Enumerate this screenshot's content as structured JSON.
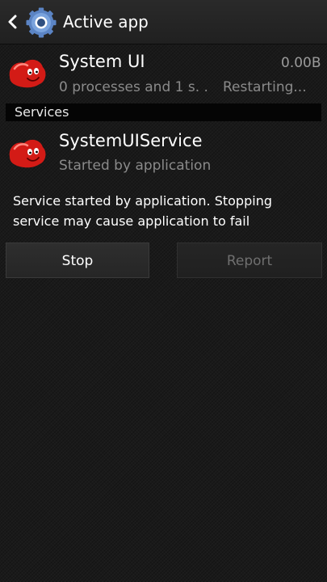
{
  "header": {
    "title": "Active app"
  },
  "app": {
    "name": "System UI",
    "size": "0.00B",
    "processes": "0 processes and 1 s. .",
    "status": "Restarting..."
  },
  "services_section": {
    "label": "Services"
  },
  "service": {
    "name": "SystemUIService",
    "subtitle": "Started by application"
  },
  "description": "Service started by application. Stopping service may cause application to fail",
  "buttons": {
    "stop": "Stop",
    "report": "Report"
  },
  "colors": {
    "background": "#1a1a1a",
    "section_header_bg": "#050505",
    "secondary_text": "#8a8a8a",
    "app_icon_red": "#e0201b",
    "disabled_text": "#6f6f6f"
  },
  "icons": {
    "back": "back-chevron-icon",
    "settings": "gear-icon",
    "app": "jellybean-android-icon"
  }
}
